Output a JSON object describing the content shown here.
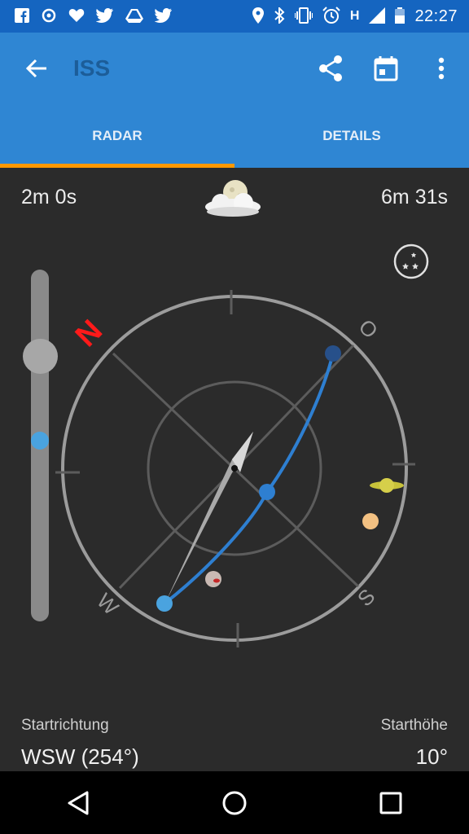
{
  "status_bar": {
    "time": "22:27",
    "network_label": "H",
    "left_icons": [
      "facebook-icon",
      "sync-icon",
      "heart-icon",
      "twitter-icon",
      "drive-icon",
      "twitter-icon"
    ],
    "right_icons": [
      "location-icon",
      "bluetooth-icon",
      "vibrate-icon",
      "alarm-icon",
      "signal-icon",
      "battery-icon"
    ]
  },
  "app_bar": {
    "title": "ISS",
    "accent": "#2f86d3"
  },
  "tabs": [
    {
      "label": "RADAR",
      "active": true
    },
    {
      "label": "DETAILS",
      "active": false
    }
  ],
  "radar": {
    "time_before": "2m 0s",
    "time_after": "6m 31s",
    "weather_icon": "moon-cloud-icon",
    "compass": {
      "north": "N",
      "east": "O",
      "south": "S",
      "west": "W"
    }
  },
  "info": {
    "start_direction_label": "Startrichtung",
    "start_direction_value": "WSW (254°)",
    "start_height_label": "Starthöhe",
    "start_height_value": "10°"
  }
}
